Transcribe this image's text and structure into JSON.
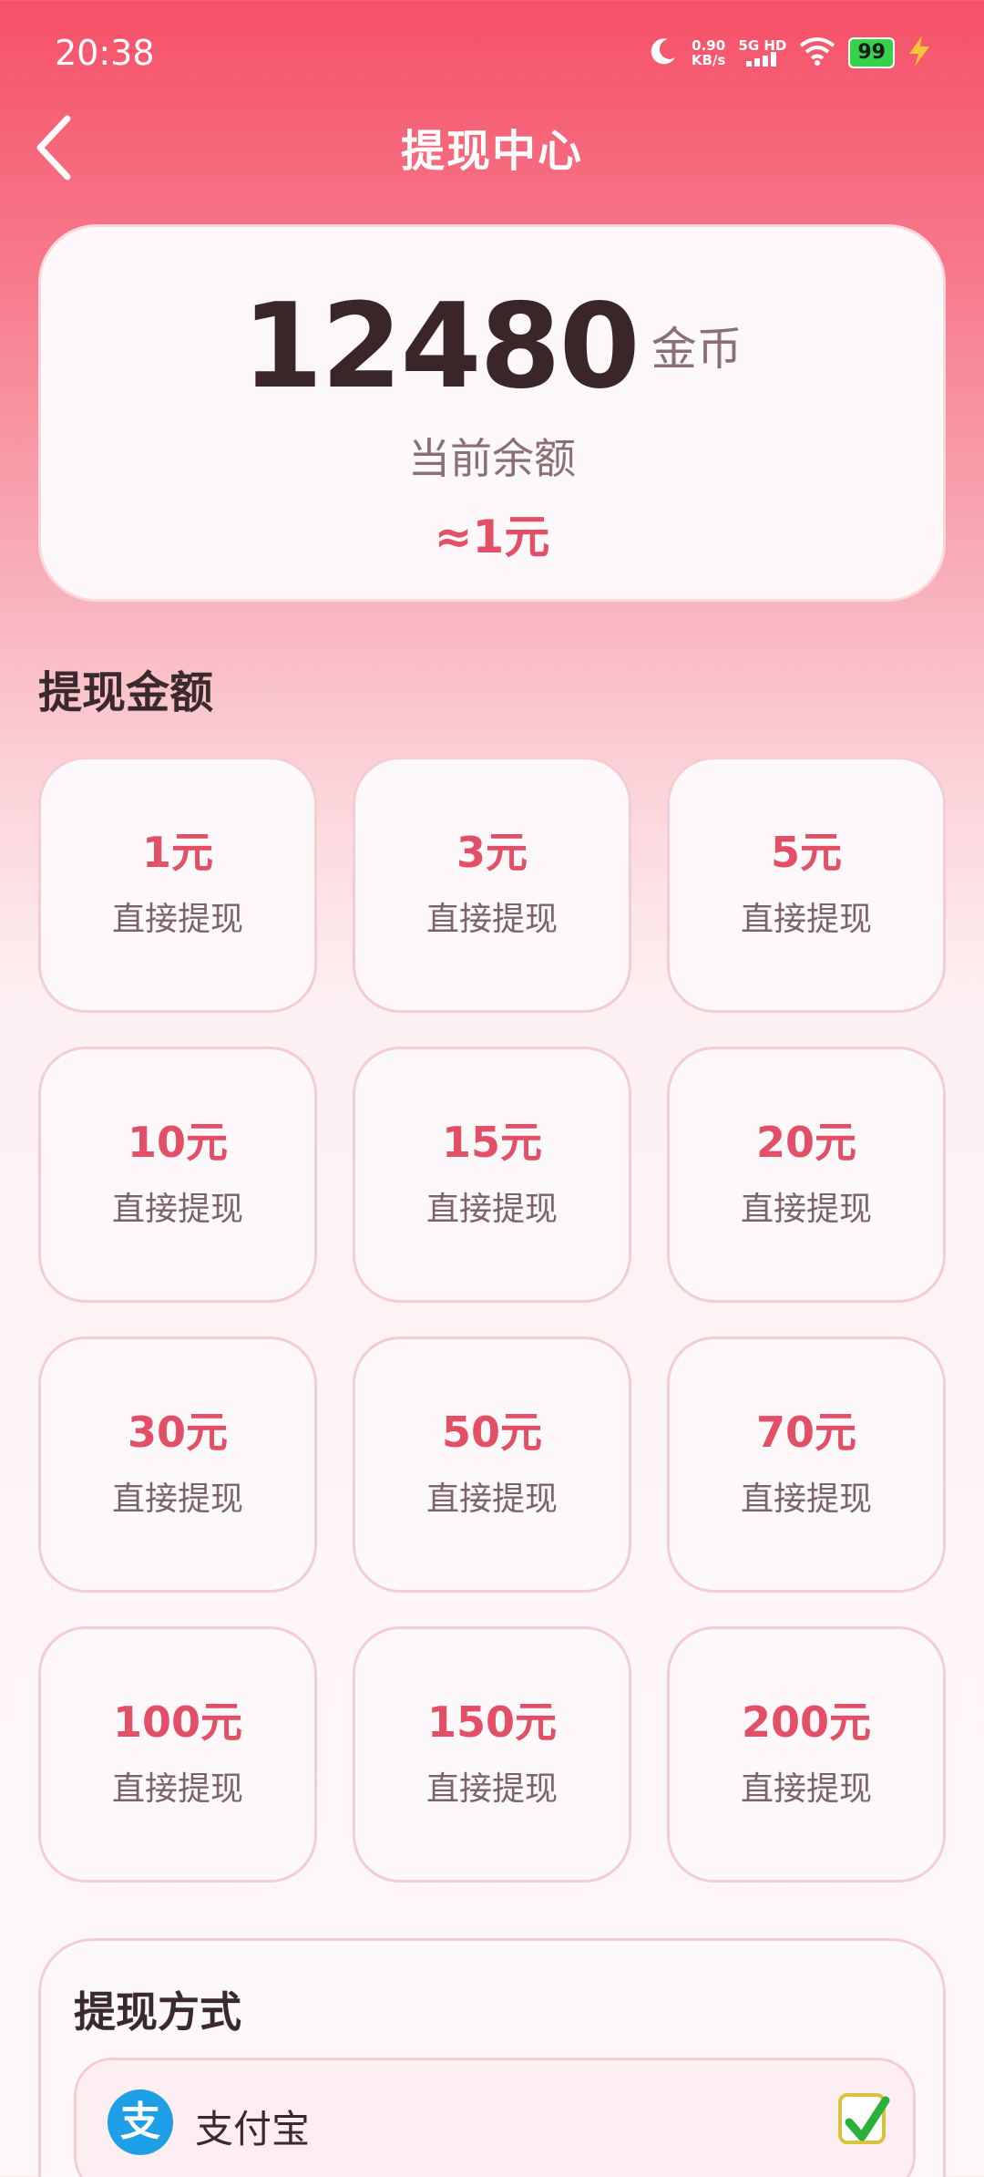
{
  "status_bar": {
    "time": "20:38",
    "net_speed_value": "0.90",
    "net_speed_unit": "KB/s",
    "signal_label": "5G HD",
    "battery": "99"
  },
  "nav": {
    "title": "提现中心"
  },
  "balance": {
    "value": "12480",
    "unit": "金币",
    "label": "当前余额",
    "approx": "≈1元"
  },
  "amount_section": {
    "title": "提现金额",
    "options": [
      {
        "amount": "1元",
        "desc": "直接提现"
      },
      {
        "amount": "3元",
        "desc": "直接提现"
      },
      {
        "amount": "5元",
        "desc": "直接提现"
      },
      {
        "amount": "10元",
        "desc": "直接提现"
      },
      {
        "amount": "15元",
        "desc": "直接提现"
      },
      {
        "amount": "20元",
        "desc": "直接提现"
      },
      {
        "amount": "30元",
        "desc": "直接提现"
      },
      {
        "amount": "50元",
        "desc": "直接提现"
      },
      {
        "amount": "70元",
        "desc": "直接提现"
      },
      {
        "amount": "100元",
        "desc": "直接提现"
      },
      {
        "amount": "150元",
        "desc": "直接提现"
      },
      {
        "amount": "200元",
        "desc": "直接提现"
      }
    ]
  },
  "method_section": {
    "title": "提现方式",
    "option_label": "支付宝",
    "option_icon": "支",
    "selected": true
  },
  "colors": {
    "accent": "#e24f66",
    "header_gradient_top": "#f65068"
  }
}
